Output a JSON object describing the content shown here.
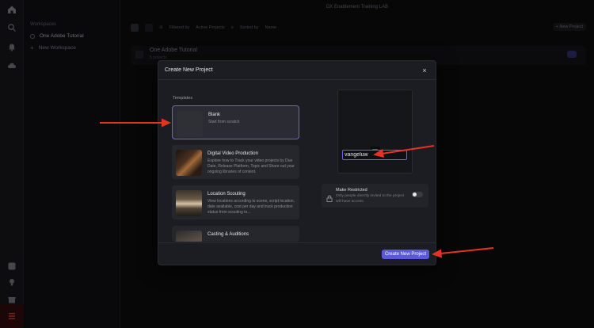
{
  "app": {
    "title": "DX Enablement Training LAB"
  },
  "colors": {
    "accent": "#5a5ad6",
    "selected_border": "#6a63e0",
    "annotation": "#e53323"
  },
  "rail": {
    "icons": [
      "home-icon",
      "search-icon",
      "bell-icon",
      "cloud-icon",
      "help-icon",
      "bulb-icon",
      "gift-icon",
      "apps-icon"
    ]
  },
  "sidebar": {
    "section_label": "Workspaces",
    "items": [
      {
        "label": "One Adobe Tutorial"
      },
      {
        "label": "New Workspace"
      }
    ]
  },
  "toolbar": {
    "filter_label": "Filtered by",
    "filter_value": "Active Projects",
    "sort_label": "Sorted by",
    "sort_value": "Name",
    "new_project_label": "+ New Project"
  },
  "background_project": {
    "title": "One Adobe Tutorial",
    "subtitle": "5 projects"
  },
  "modal": {
    "title": "Create New Project",
    "close_symbol": "×",
    "templates_label": "Templates",
    "templates": [
      {
        "name": "Blank",
        "description": "Start from scratch"
      },
      {
        "name": "Digital Video Production",
        "description": "Explore how to Track your video projects by Due Date, Release Platform, Topic and Share out your ongoing libraries of content."
      },
      {
        "name": "Location Scouting",
        "description": "View locations according to scene, script location, date available, cost per day and track production status from scouting to..."
      },
      {
        "name": "Casting & Auditions",
        "description": ""
      }
    ],
    "project_name_value": "vangeluw",
    "restrict": {
      "title": "Make Restricted",
      "description": "Only people directly invited to the project will have access."
    },
    "create_label": "Create New Project"
  }
}
